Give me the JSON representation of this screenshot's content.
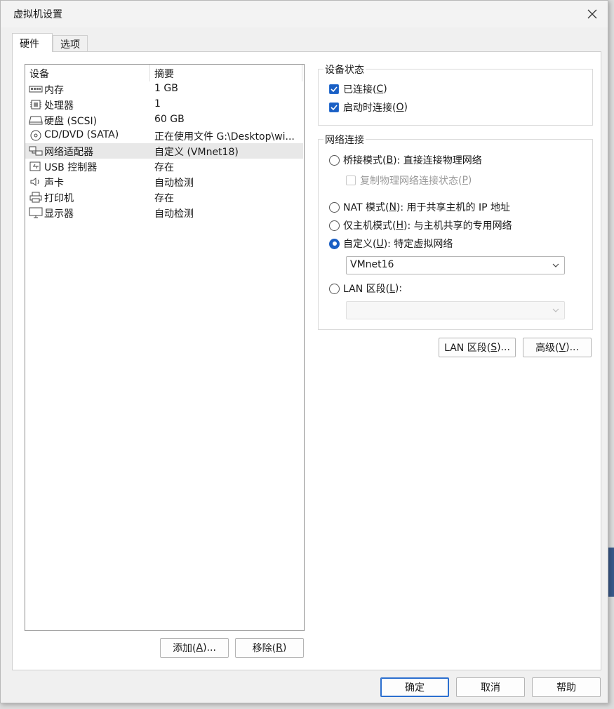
{
  "window": {
    "title": "虚拟机设置"
  },
  "tabs": [
    {
      "label": "硬件",
      "active": true
    },
    {
      "label": "选项",
      "active": false
    }
  ],
  "device_list": {
    "columns": [
      "设备",
      "摘要"
    ],
    "rows": [
      {
        "icon": "memory-icon",
        "name": "内存",
        "summary": "1 GB"
      },
      {
        "icon": "processor-icon",
        "name": "处理器",
        "summary": "1"
      },
      {
        "icon": "hard-disk-icon",
        "name": "硬盘 (SCSI)",
        "summary": "60 GB"
      },
      {
        "icon": "cd-dvd-icon",
        "name": "CD/DVD (SATA)",
        "summary": "正在使用文件 G:\\Desktop\\wi..."
      },
      {
        "icon": "network-adapter-icon",
        "name": "网络适配器",
        "summary": "自定义 (VMnet18)",
        "selected": true
      },
      {
        "icon": "usb-icon",
        "name": "USB 控制器",
        "summary": "存在"
      },
      {
        "icon": "sound-card-icon",
        "name": "声卡",
        "summary": "自动检测"
      },
      {
        "icon": "printer-icon",
        "name": "打印机",
        "summary": "存在"
      },
      {
        "icon": "display-icon",
        "name": "显示器",
        "summary": "自动检测"
      }
    ]
  },
  "list_buttons": {
    "add": {
      "text": "添加(",
      "key": "A",
      "tail": ")..."
    },
    "remove": {
      "text": "移除(",
      "key": "R",
      "tail": ")"
    }
  },
  "device_status": {
    "legend": "设备状态",
    "connected": {
      "text": "已连接(",
      "key": "C",
      "tail": ")",
      "checked": true
    },
    "connect_at_power_on": {
      "text": "启动时连接(",
      "key": "O",
      "tail": ")",
      "checked": true
    }
  },
  "network_connection": {
    "legend": "网络连接",
    "bridged": {
      "text": "桥接模式(",
      "key": "B",
      "tail": "): 直接连接物理网络",
      "selected": false
    },
    "replicate": {
      "text": "复制物理网络连接状态(",
      "key": "P",
      "tail": ")",
      "checked": false,
      "disabled": true
    },
    "nat": {
      "text": "NAT 模式(",
      "key": "N",
      "tail": "): 用于共享主机的 IP 地址",
      "selected": false
    },
    "host_only": {
      "text": "仅主机模式(",
      "key": "H",
      "tail": "): 与主机共享的专用网络",
      "selected": false
    },
    "custom": {
      "text": "自定义(",
      "key": "U",
      "tail": "): 特定虚拟网络",
      "selected": true
    },
    "custom_select_value": "VMnet16",
    "lan_segment": {
      "text": "LAN 区段(",
      "key": "L",
      "tail": "):",
      "selected": false
    },
    "lan_select_value": ""
  },
  "network_buttons": {
    "lan_segments": {
      "text": "LAN 区段(",
      "key": "S",
      "tail": ")..."
    },
    "advanced": {
      "text": "高级(",
      "key": "V",
      "tail": ")..."
    }
  },
  "footer_buttons": {
    "ok": "确定",
    "cancel": "取消",
    "help": "帮助"
  },
  "colors": {
    "accent": "#1a5fc4",
    "selected_row": "#e8e8e8",
    "panel": "#ffffff",
    "dialog": "#f0f0f0"
  }
}
